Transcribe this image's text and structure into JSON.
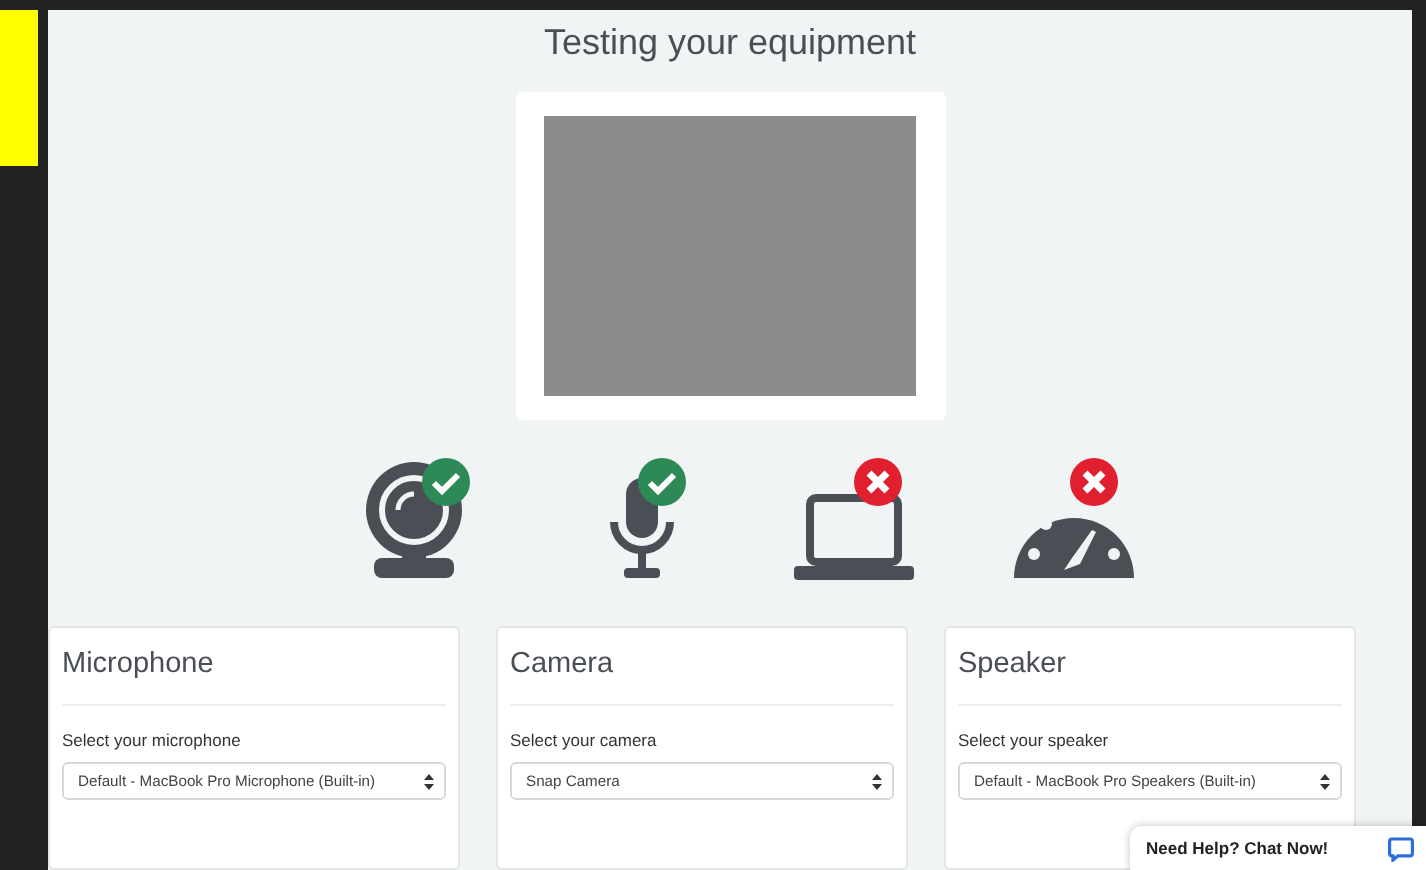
{
  "title": "Testing your equipment",
  "devices": [
    {
      "kind": "webcam",
      "ok": true
    },
    {
      "kind": "microphone",
      "ok": true
    },
    {
      "kind": "laptop",
      "ok": false
    },
    {
      "kind": "gauge",
      "ok": false
    }
  ],
  "cards": [
    {
      "title": "Microphone",
      "label": "Select your microphone",
      "value": "Default - MacBook Pro Microphone (Built-in)"
    },
    {
      "title": "Camera",
      "label": "Select your camera",
      "value": "Snap Camera"
    },
    {
      "title": "Speaker",
      "label": "Select your speaker",
      "value": "Default - MacBook Pro Speakers (Built-in)"
    }
  ],
  "chat": {
    "label": "Need Help? Chat Now!"
  }
}
